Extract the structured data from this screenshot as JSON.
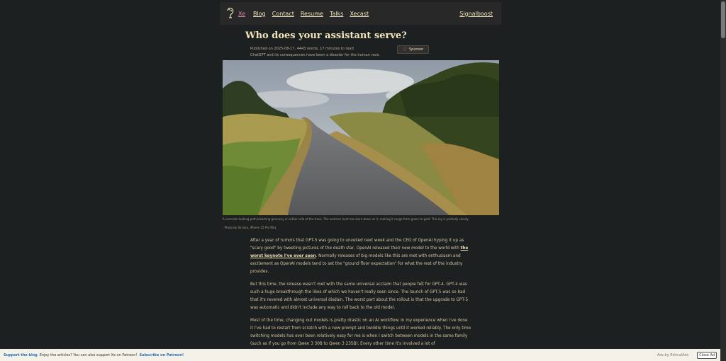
{
  "nav": {
    "brand": "Xe",
    "links": [
      "Blog",
      "Contact",
      "Resume",
      "Talks",
      "Xecast"
    ],
    "right": "Signalboost"
  },
  "post": {
    "title": "Who does your assistant serve?",
    "meta": "Published on 2025-08-17, 4443 words, 17 minutes to read",
    "description": "ChatGPT and its consequences have been a disaster for the human race.",
    "sponsor_label": "Sponsor",
    "image_caption": "A concrete-looking path bisecting greenery on either side of the trees. The summer heat has worn down on it, making it range from green to gold. The sky is partially cloudy.",
    "image_credit": "- Photo by Xe Iaso, iPhone 15 Pro Max",
    "p1_before": "After a year of rumors that GPT-5 was going to unveiled next week and the CEO of OpenAI hyping it up as \"scary good\" by tweeting pictures of the death star, OpenAI released their new model to the world with ",
    "p1_link": "the worst keynote I've ever seen",
    "p1_after": ". Normally releases of big models like this are met with enthusiasm and excitement as OpenAI models tend to set the \"ground floor expectation\" for what the rest of the industry provides.",
    "p2": "But this time, the release wasn't met with the same universal acclaim that people felt for GPT-4. GPT-4 was such a huge breakthrough the likes of which we haven't really seen since. The launch of GPT-5 was so bad that it's revered with almost universal disdain. The worst part about the rollout is that the upgrade to GPT-5 was automatic and didn't include any way to roll back to the old model.",
    "p3": "Most of the time, changing out models is pretty drastic on an AI workflow. In my experience when I've done it I've had to restart from scratch with a new prompt and twiddle things until it worked reliably. The only time switching models has ever been relatively easy for me is when I switch between models in the same family (such as if you go from Qwen 3 30B to Qwen 3 235B). Every other time it's involved a lot of"
  },
  "ad": {
    "support_link": "Support the blog",
    "text": "Enjoy the articles? You can also support Xe on Patreon!",
    "subscribe_link": "Subscribe on Patreon!",
    "ads_by": "Ads by EthicalAds",
    "close": "Close Ad"
  },
  "colors": {
    "background": "#1d2021",
    "link": "#f2e5bc",
    "brand": "#d3869b",
    "ad_link": "#2a6fb0"
  }
}
